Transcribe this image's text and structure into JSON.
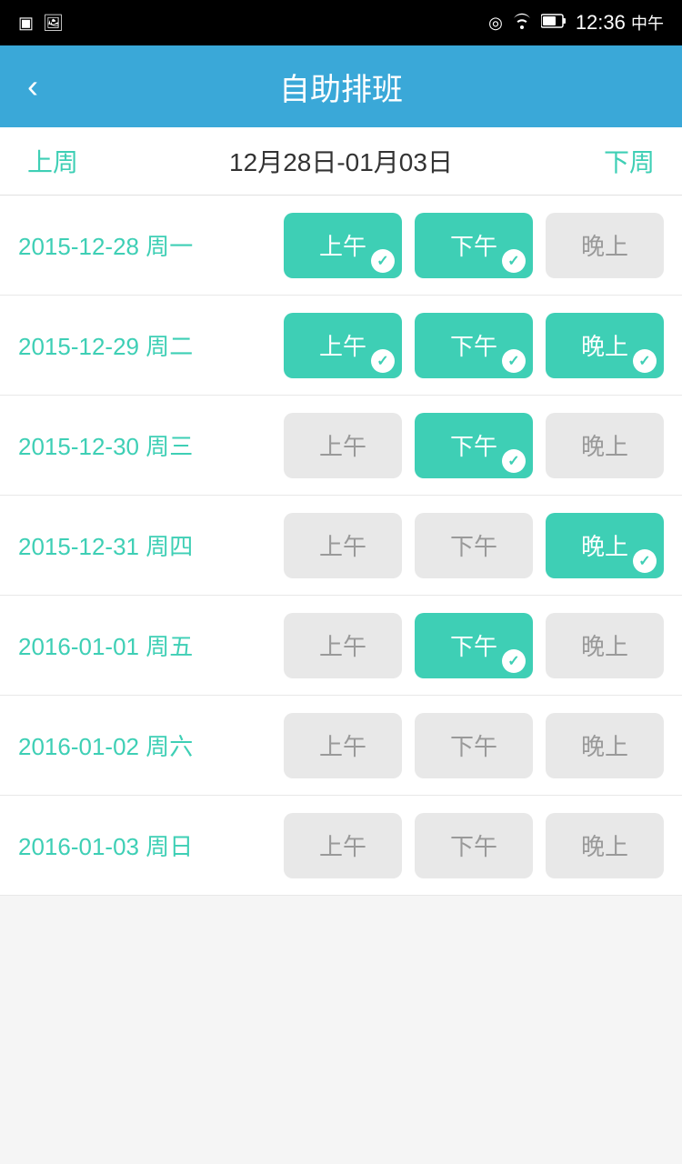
{
  "statusBar": {
    "time": "12:36",
    "period": "中午",
    "icons": {
      "location": "📍",
      "wifi": "WiFi",
      "battery": "Battery"
    }
  },
  "header": {
    "title": "自助排班",
    "backLabel": "‹"
  },
  "weekNav": {
    "prevLabel": "上周",
    "nextLabel": "下周",
    "dateRange": "12月28日-01月03日"
  },
  "schedule": [
    {
      "date": "2015-12-28 周一",
      "slots": [
        {
          "label": "上午",
          "active": true
        },
        {
          "label": "下午",
          "active": true
        },
        {
          "label": "晚上",
          "active": false
        }
      ]
    },
    {
      "date": "2015-12-29 周二",
      "slots": [
        {
          "label": "上午",
          "active": true
        },
        {
          "label": "下午",
          "active": true
        },
        {
          "label": "晚上",
          "active": true
        }
      ]
    },
    {
      "date": "2015-12-30 周三",
      "slots": [
        {
          "label": "上午",
          "active": false
        },
        {
          "label": "下午",
          "active": true
        },
        {
          "label": "晚上",
          "active": false
        }
      ]
    },
    {
      "date": "2015-12-31 周四",
      "slots": [
        {
          "label": "上午",
          "active": false
        },
        {
          "label": "下午",
          "active": false
        },
        {
          "label": "晚上",
          "active": true
        }
      ]
    },
    {
      "date": "2016-01-01 周五",
      "slots": [
        {
          "label": "上午",
          "active": false
        },
        {
          "label": "下午",
          "active": true
        },
        {
          "label": "晚上",
          "active": false
        }
      ]
    },
    {
      "date": "2016-01-02 周六",
      "slots": [
        {
          "label": "上午",
          "active": false
        },
        {
          "label": "下午",
          "active": false
        },
        {
          "label": "晚上",
          "active": false
        }
      ]
    },
    {
      "date": "2016-01-03 周日",
      "slots": [
        {
          "label": "上午",
          "active": false
        },
        {
          "label": "下午",
          "active": false
        },
        {
          "label": "晚上",
          "active": false
        }
      ]
    }
  ]
}
